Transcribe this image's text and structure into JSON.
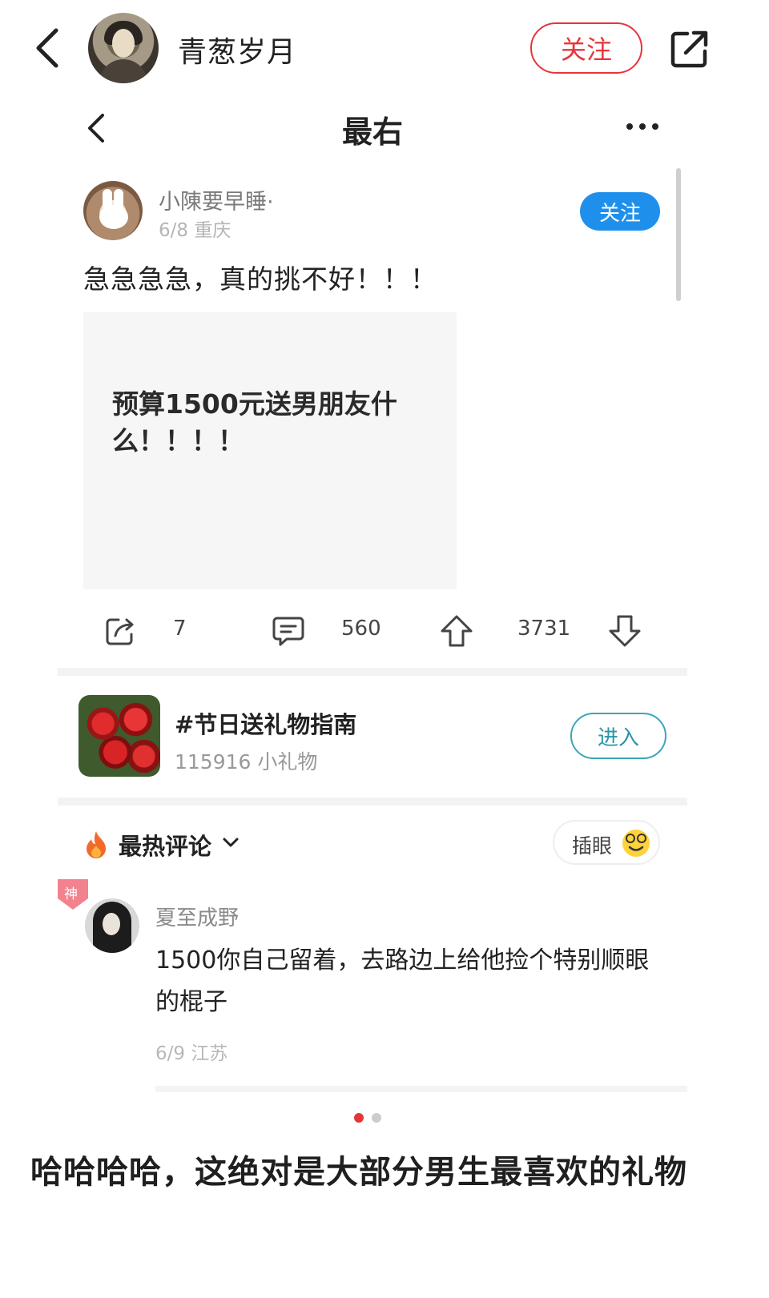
{
  "outer_header": {
    "user_name": "青葱岁月",
    "follow_label": "关注"
  },
  "inner": {
    "nav_title": "最右",
    "post": {
      "user_name": "小陳要早睡·",
      "meta": "6/8 重庆",
      "follow_label": "关注",
      "text": "急急急急，真的挑不好！！！",
      "image_text": "预算1500元送男朋友什么！！！！"
    },
    "actions": {
      "share_count": "7",
      "comment_count": "560",
      "upvote_count": "3731"
    },
    "topic": {
      "title": "#节日送礼物指南",
      "count": "115916 小礼物",
      "enter_label": "进入"
    },
    "comments_header": {
      "label": "最热评论",
      "insert_label": "插眼"
    },
    "comment": {
      "badge": "神",
      "user_name": "夏至成野",
      "text": "1500你自己留着，去路边上给他捡个特别顺眼的棍子",
      "meta": "6/9 江苏"
    }
  },
  "pager": {
    "total": 2,
    "active": 1
  },
  "caption": "哈哈哈哈，这绝对是大部分男生最喜欢的礼物",
  "colors": {
    "outer_follow": "#e5353b",
    "inner_follow": "#1e90ec",
    "enter": "#3aa6b8",
    "pager_active": "#e5353b",
    "pager_inactive": "#cccccc"
  },
  "icons": [
    "back-icon",
    "share-icon",
    "more-icon",
    "repost-icon",
    "comment-icon",
    "upvote-icon",
    "downvote-icon",
    "fire-icon",
    "chevron-down-icon",
    "smile-emoji-icon"
  ]
}
